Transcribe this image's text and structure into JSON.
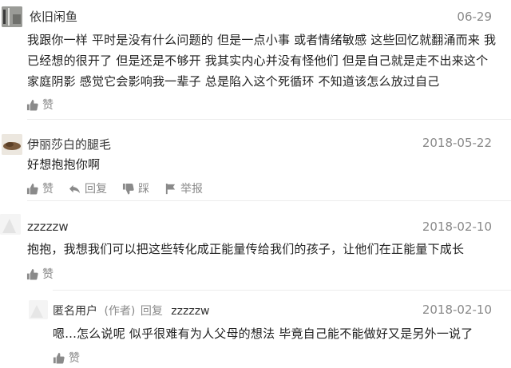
{
  "comments": [
    {
      "author": "依旧闲鱼",
      "date": "06-29",
      "text": "我跟你一样 平时是没有什么问题的 但是一点小事 或者情绪敏感 这些回忆就翻涌而来 我已经想的很开了 但是还是不够开 我其实内心并没有怪他们 但是自己就是走不出来这个家庭阴影 感觉它会影响我一辈子 总是陷入这个死循环 不知道该怎么放过自己",
      "like_label": "赞"
    },
    {
      "author": "伊丽莎白的腿毛",
      "date": "2018-05-22",
      "text": "好想抱抱你啊",
      "like_label": "赞",
      "reply_label": "回复",
      "dislike_label": "踩",
      "report_label": "举报"
    },
    {
      "author": "zzzzzw",
      "date": "2018-02-10",
      "text": "抱抱，我想我们可以把这些转化成正能量传给我们的孩子，让他们在正能量下成长",
      "like_label": "赞"
    }
  ],
  "reply": {
    "author": "匿名用户",
    "author_tag": "(作者)",
    "reply_word": "回复",
    "reply_to": "zzzzzw",
    "date": "2018-02-10",
    "text": "嗯...怎么说呢 似乎很难有为人父母的想法 毕竟自己能不能做好又是另外一说了",
    "like_label": "赞"
  }
}
